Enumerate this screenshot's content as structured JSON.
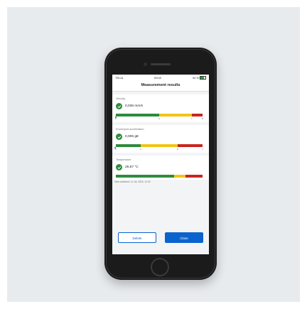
{
  "status_bar": {
    "carrier": "TELIA",
    "time": "09:02",
    "battery": "94 %"
  },
  "nav": {
    "title": "Measurement results"
  },
  "measurements": [
    {
      "label": "Velocity",
      "value": "0,036 mm/s",
      "status": "ok",
      "ticks": [
        "0",
        "4",
        "7",
        "8"
      ],
      "marker_value": 0.036,
      "scale_max": 8,
      "zones": [
        {
          "color": "#2e8b3e",
          "from": 0,
          "to": 4
        },
        {
          "color": "#f2c417",
          "from": 4,
          "to": 7
        },
        {
          "color": "#c9251f",
          "from": 7,
          "to": 8
        }
      ]
    },
    {
      "label": "Enveloped acceleration",
      "value": "0,005 gE",
      "status": "ok",
      "ticks": [
        "0",
        "2",
        "5",
        "7"
      ],
      "marker_value": 0.005,
      "scale_max": 7,
      "zones": [
        {
          "color": "#2e8b3e",
          "from": 0,
          "to": 2
        },
        {
          "color": "#f2c417",
          "from": 2,
          "to": 5
        },
        {
          "color": "#c9251f",
          "from": 5,
          "to": 7
        }
      ]
    },
    {
      "label": "Temperature",
      "value": "25,87 °C",
      "status": "ok",
      "ticks": [],
      "zones_fraction": [
        {
          "color": "#2e8b3e",
          "fraction": 0.67
        },
        {
          "color": "#f2c417",
          "fraction": 0.13
        },
        {
          "color": "#c9251f",
          "fraction": 0.2
        }
      ]
    }
  ],
  "date_collected": "Data collected: 11 Jul, 2019, 12:32",
  "buttons": {
    "delete": "Delete",
    "close": "Close"
  },
  "colors": {
    "ok": "#2e8b3e",
    "warning": "#f2c417",
    "alarm": "#c9251f",
    "accent": "#0b63ce"
  }
}
